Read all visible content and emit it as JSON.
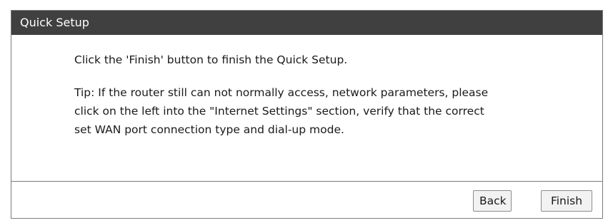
{
  "panel": {
    "title": "Quick Setup"
  },
  "content": {
    "message": "Click the 'Finish' button to finish the Quick Setup.",
    "tip_lines": [
      "Tip: If the router still can not normally access, network parameters, please",
      "click on the left into the \"Internet Settings\" section, verify that the correct",
      "set WAN port connection type and dial-up mode."
    ]
  },
  "buttons": {
    "back_label": "Back",
    "finish_label": "Finish"
  }
}
